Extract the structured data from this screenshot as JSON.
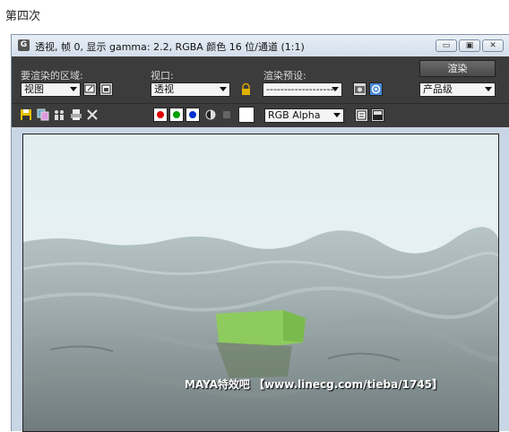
{
  "caption": "第四次",
  "window": {
    "title": "透视, 帧 0, 显示 gamma: 2.2, RGBA 颜色 16 位/通道 (1:1)",
    "app_icon_glyph": "G"
  },
  "panel": {
    "area_label": "要渲染的区域:",
    "area_value": "视图",
    "viewport_label": "视口:",
    "viewport_value": "透视",
    "preset_label": "渲染预设:",
    "preset_value": "--------------------",
    "render_button": "渲染",
    "quality_value": "产品级"
  },
  "toolbar": {
    "channel_value": "RGB Alpha",
    "colors": {
      "red": "#e00000",
      "green": "#00a000",
      "blue": "#0030d0"
    }
  },
  "watermark": "MAYA特效吧   【www.linecg.com/tieba/1745】"
}
